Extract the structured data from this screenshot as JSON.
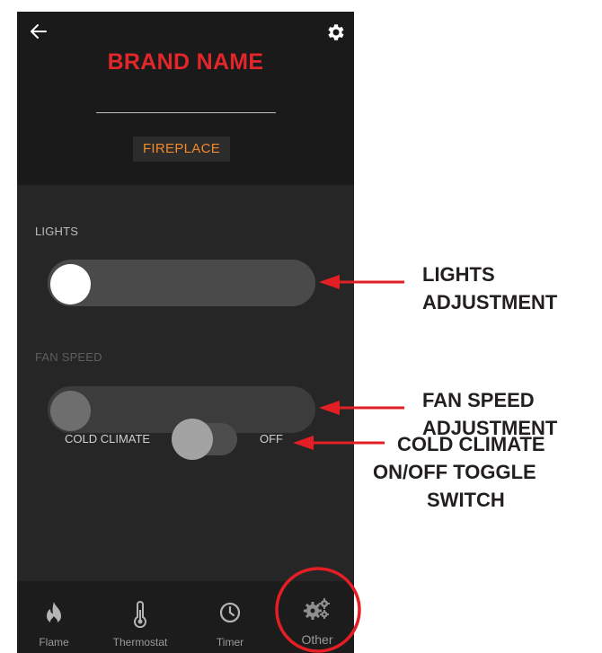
{
  "header": {
    "brand": "BRAND NAME",
    "device_tab": "FIREPLACE"
  },
  "controls": {
    "lights_label": "LIGHTS",
    "lights_level": 0,
    "fan_label": "FAN SPEED",
    "fan_level": 0,
    "cold_climate_label": "COLD CLIMATE",
    "cold_climate_state": "OFF"
  },
  "nav": {
    "items": [
      {
        "label": "Flame",
        "icon": "flame-icon"
      },
      {
        "label": "Thermostat",
        "icon": "thermometer-icon"
      },
      {
        "label": "Timer",
        "icon": "clock-icon"
      },
      {
        "label": "Other",
        "icon": "gears-icon",
        "active": true
      }
    ]
  },
  "callouts": {
    "lights": [
      "LIGHTS",
      "ADJUSTMENT"
    ],
    "fan": [
      "FAN SPEED",
      "ADJUSTMENT"
    ],
    "cold": [
      "COLD CLIMATE",
      "ON/OFF TOGGLE",
      "SWITCH"
    ]
  },
  "colors": {
    "brand": "#e3262a",
    "device_tab": "#f08a2a",
    "arrow": "#e31e24",
    "highlight_circle": "#e31e24"
  }
}
